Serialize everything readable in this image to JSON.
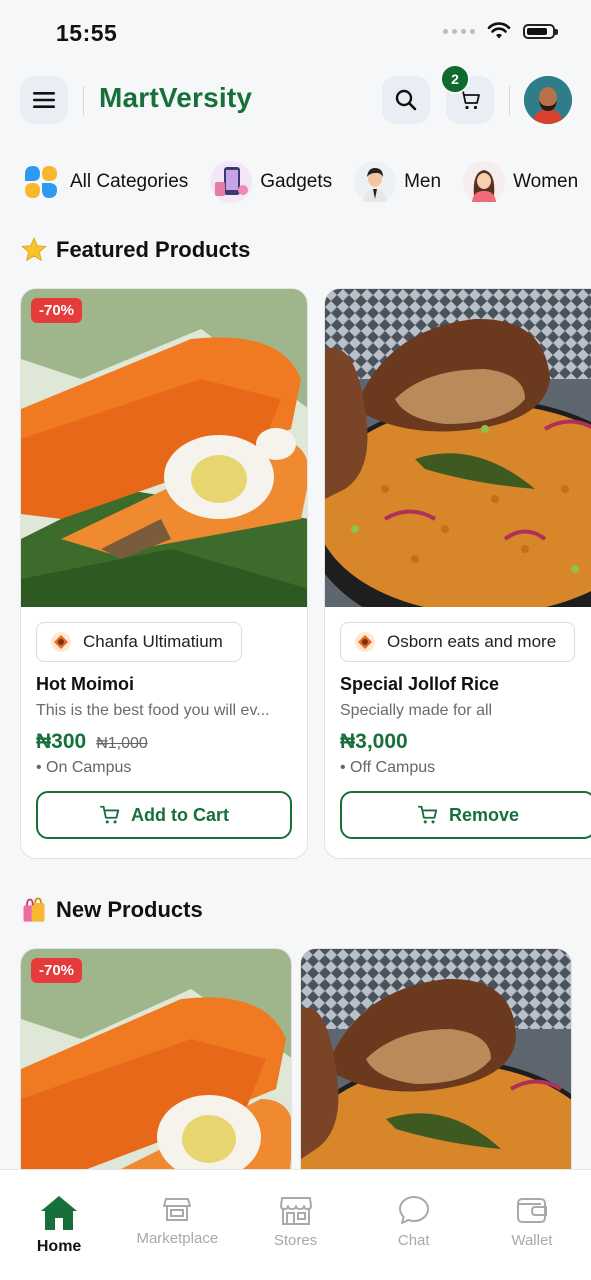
{
  "status_bar": {
    "time": "15:55"
  },
  "header": {
    "brand": "MartVersity",
    "cart_count": "2"
  },
  "categories": [
    {
      "label": "All Categories",
      "icon": "grid-icon"
    },
    {
      "label": "Gadgets",
      "icon": "gadgets-icon"
    },
    {
      "label": "Men",
      "icon": "man-icon"
    },
    {
      "label": "Women",
      "icon": "woman-icon"
    }
  ],
  "featured": {
    "title": "Featured Products",
    "products": [
      {
        "discount": "-70%",
        "vendor": "Chanfa Ultimatium",
        "name": "Hot Moimoi",
        "desc": "This is the best food you will ev...",
        "price": "₦300",
        "old_price": "₦1,000",
        "location": "• On Campus",
        "button": "Add to Cart"
      },
      {
        "vendor": "Osborn eats and more",
        "name": "Special Jollof Rice",
        "desc": "Specially made for all",
        "price": "₦3,000",
        "location": "• Off Campus",
        "button": "Remove"
      }
    ]
  },
  "new_products": {
    "title": "New Products",
    "products": [
      {
        "discount": "-70%"
      }
    ]
  },
  "tabs": [
    {
      "label": "Home",
      "icon": "home-icon",
      "active": true
    },
    {
      "label": "Marketplace",
      "icon": "marketplace-icon"
    },
    {
      "label": "Stores",
      "icon": "store-icon"
    },
    {
      "label": "Chat",
      "icon": "chat-icon"
    },
    {
      "label": "Wallet",
      "icon": "wallet-icon"
    }
  ],
  "colors": {
    "brand": "#17703a",
    "discount": "#e63b3b",
    "badge": "#0f6a2d"
  }
}
